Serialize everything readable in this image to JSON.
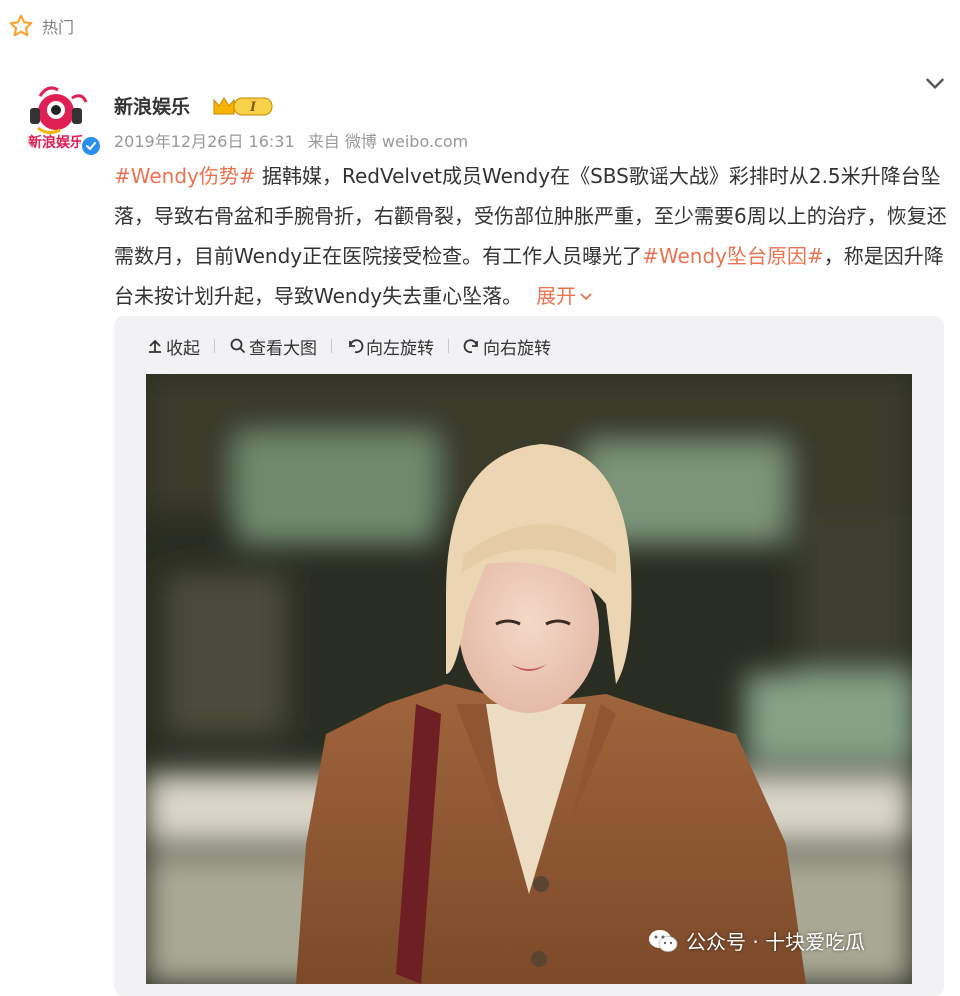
{
  "header": {
    "hot_label": "热门",
    "star_icon": "star-outline-icon",
    "collapse_icon": "chevron-down-icon"
  },
  "post": {
    "author": {
      "name": "新浪娱乐",
      "avatar_text": "新浪娱乐",
      "vip_badge": "I",
      "verified_icon": "verified-check-icon"
    },
    "timestamp": "2019年12月26日 16:31",
    "source": "来自 微博 weibo.com",
    "text": {
      "tag1": "#Wendy伤势#",
      "body1": " 据韩媒，RedVelvet成员Wendy在《SBS歌谣大战》彩排时从2.5米升降台坠落，导致右骨盆和手腕骨折，右颧骨裂，受伤部位肿胀严重，至少需要6周以上的治疗，恢复还需数月，目前Wendy正在医院接受检查。有工作人员曝光了",
      "tag2": "#Wendy坠台原因#",
      "body2": "，称是因升降台未按计划升起，导致Wendy失去重心坠落。",
      "expand": "展开"
    },
    "media_toolbar": {
      "collapse": "收起",
      "view_large": "查看大图",
      "rotate_left": "向左旋转",
      "rotate_right": "向右旋转"
    },
    "watermark": "公众号 · 十块爱吃瓜"
  },
  "colors": {
    "accent": "#eb7350",
    "meta": "#999999",
    "text": "#333333",
    "card_bg": "#f2f2f5",
    "verified": "#2b8ff0"
  }
}
